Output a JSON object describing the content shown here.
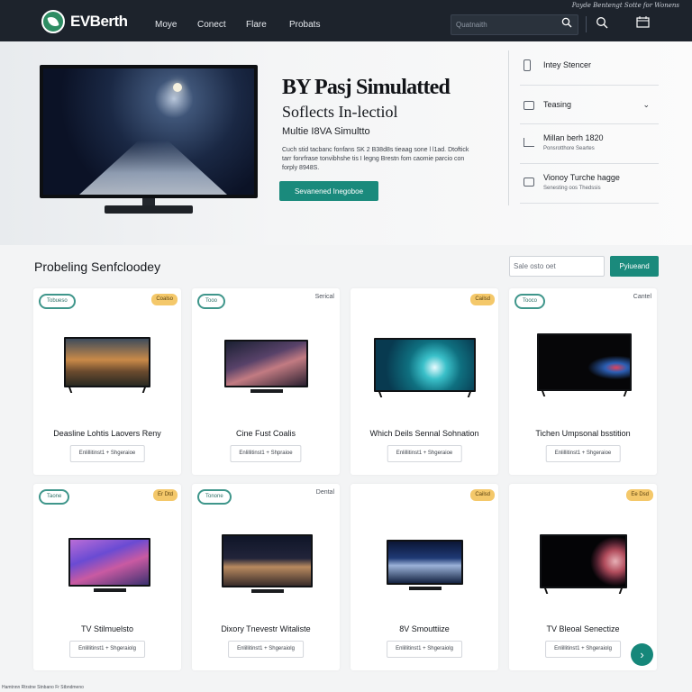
{
  "header": {
    "tagline": "Payde Bentengt Sotte for Wonens",
    "brand": "EVBerth",
    "nav": [
      "Moye",
      "Conect",
      "Flare",
      "Probats"
    ],
    "search_placeholder": "Quatnaith"
  },
  "hero": {
    "title": "BY Pasj Simulatted",
    "subtitle": "Soflects In-lectiol",
    "subtitle2": "Multie I8VA Simultto",
    "description": "Cuch stid tacbanc fonfans SK 2 B38d8s tieaag sone l l1ad. Dtoftick tarr fonrfrase tonvibhshe tis I legng Brestn fom caomie parcio con forply 8948S.",
    "cta": "Sevanened Inegoboe"
  },
  "sidepanel": {
    "items": [
      {
        "title": "Intey Stencer",
        "sub": ""
      },
      {
        "title": "Teasing",
        "sub": ""
      },
      {
        "title": "Millan berh 1820",
        "sub": "Ponsrotthore Seartes"
      },
      {
        "title": "Vionoy Turche hagge",
        "sub": "Senesting oos Thedssis"
      }
    ]
  },
  "listing": {
    "title": "Probeling Senfcloodey",
    "filter_placeholder": "Sale osto oet",
    "filter_button": "Pyiueand"
  },
  "products": [
    {
      "badge": "Tobueso",
      "tag": "Coalso",
      "tag_style": "yellow",
      "title": "Deasline Lohtis Laovers Reny",
      "chip": "Enlillitinst1 + Shgeraioe"
    },
    {
      "badge": "Tooo",
      "tag": "Serical",
      "tag_style": "text",
      "title": "Cine Fust Coalis",
      "chip": "Enlillitinst1 + Shpraioe"
    },
    {
      "badge": "",
      "tag": "Cailsd",
      "tag_style": "yellow",
      "title": "Which Deils Sennal Sohnation",
      "chip": "Enlillitinst1 + Shgeraioe"
    },
    {
      "badge": "Tooco",
      "tag": "Cantel",
      "tag_style": "text",
      "title": "Tichen Umpsonal bsstition",
      "chip": "Enlillitinst1 + Shgeraioe"
    },
    {
      "badge": "Taone",
      "tag": "Er Dtd",
      "tag_style": "yellow",
      "title": "TV Stilmuelsto",
      "chip": "Enlillitinst1 + Shgeraiolg"
    },
    {
      "badge": "Tonone",
      "tag": "Dental",
      "tag_style": "text",
      "title": "Dixory Tnevestr Witaliste",
      "chip": "Enlillitinst1 + Shgeraiolg"
    },
    {
      "badge": "",
      "tag": "Cailsd",
      "tag_style": "yellow",
      "title": "8V Smouttiize",
      "chip": "Enlillitinst1 + Shgeraiolg"
    },
    {
      "badge": "",
      "tag": "Ee Dsd",
      "tag_style": "yellow",
      "title": "TV Bleoal Senectize",
      "chip": "Enlillitinst1 + Shgeraiolg"
    }
  ],
  "footnote": "Hamtnnn Rtrstne Stnbano Fr Stbndmeno"
}
